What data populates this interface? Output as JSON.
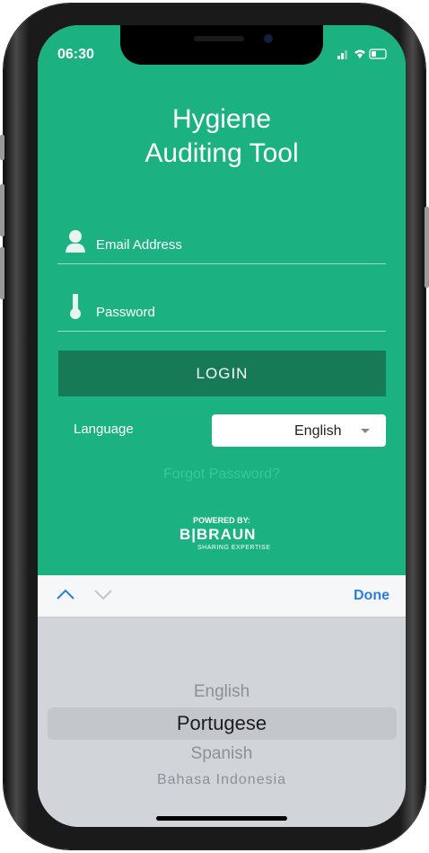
{
  "status": {
    "time": "06:30"
  },
  "app": {
    "title_line1": "Hygiene",
    "title_line2": "Auditing Tool"
  },
  "form": {
    "email_placeholder": "Email Address",
    "password_placeholder": "Password",
    "login_label": "LOGIN",
    "language_label": "Language",
    "language_selected": "English",
    "forgot_password": "Forgot Password?"
  },
  "branding": {
    "powered_by": "POWERED BY:",
    "brand": "B|BRAUN",
    "tagline": "SHARING EXPERTISE"
  },
  "keyboard_toolbar": {
    "done_label": "Done"
  },
  "picker": {
    "options": [
      "English",
      "Portugese",
      "Spanish",
      "Bahasa Indonesia"
    ],
    "selected_index": 1
  },
  "colors": {
    "primary_green": "#1cb181",
    "login_button": "#167a57",
    "forgot_link": "#34c99a",
    "done_blue": "#2b7de0"
  }
}
